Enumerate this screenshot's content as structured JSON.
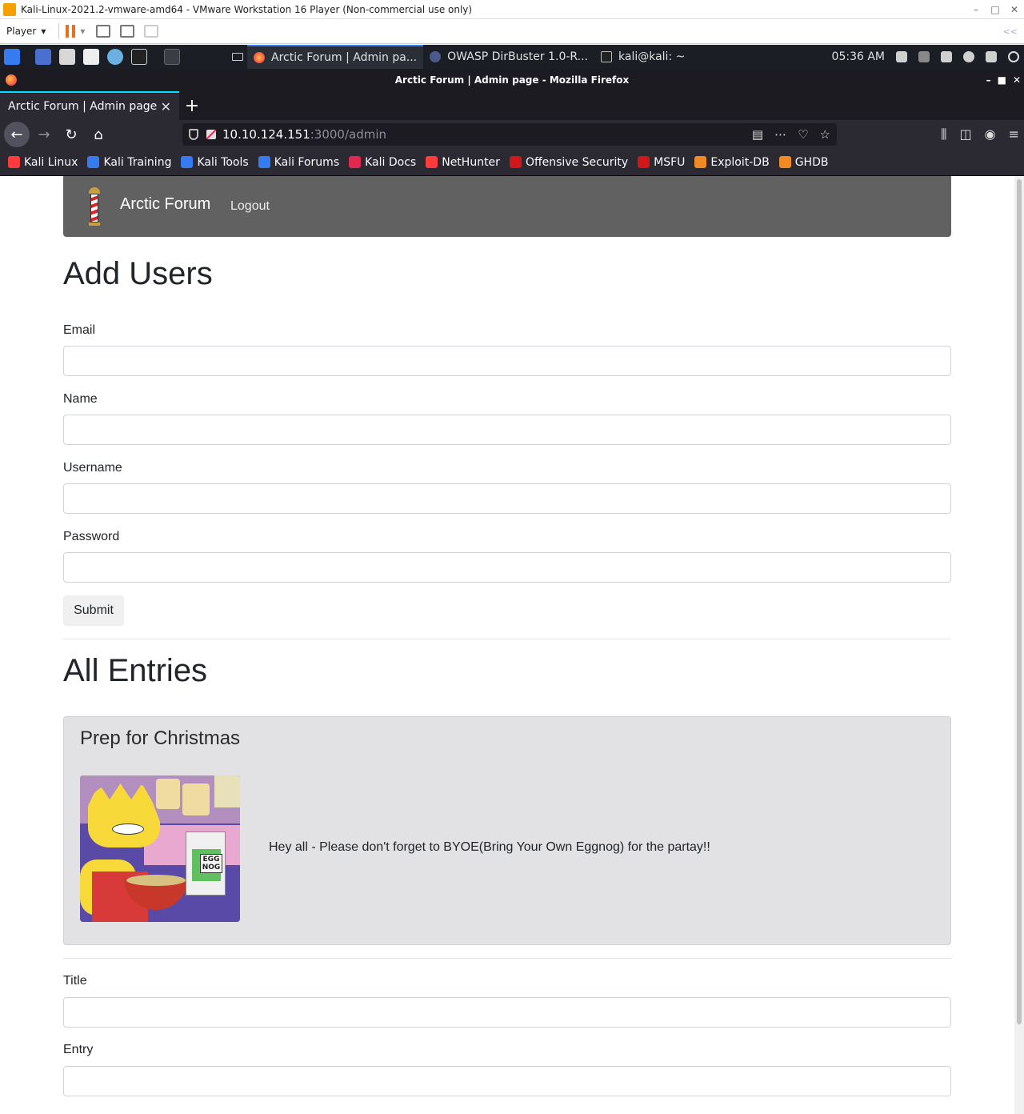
{
  "vmware": {
    "title": "Kali-Linux-2021.2-vmware-amd64 - VMware Workstation 16 Player (Non-commercial use only)",
    "player_menu": "Player",
    "window_controls": [
      "–",
      "□",
      "✕"
    ],
    "collapse_icon": "<<"
  },
  "kali_panel": {
    "tasks": [
      {
        "label": "Arctic Forum | Admin pa...",
        "icon": "firefox-icon",
        "active": true
      },
      {
        "label": "OWASP DirBuster 1.0-R...",
        "icon": "dirbuster-icon",
        "active": false
      },
      {
        "label": "kali@kali: ~",
        "icon": "terminal-icon",
        "active": false
      }
    ],
    "clock": "05:36 AM"
  },
  "firefox": {
    "window_title": "Arctic Forum | Admin page - Mozilla Firefox",
    "tab_title": "Arctic Forum | Admin page",
    "tab_close": "✕",
    "new_tab": "+",
    "url_host": "10.10.124.151",
    "url_path": ":3000/admin",
    "bookmarks": [
      {
        "label": "Kali Linux",
        "color": "#ff3b3b"
      },
      {
        "label": "Kali Training",
        "color": "#367bf0"
      },
      {
        "label": "Kali Tools",
        "color": "#367bf0"
      },
      {
        "label": "Kali Forums",
        "color": "#367bf0"
      },
      {
        "label": "Kali Docs",
        "color": "#e22850"
      },
      {
        "label": "NetHunter",
        "color": "#ff3b3b"
      },
      {
        "label": "Offensive Security",
        "color": "#d01818"
      },
      {
        "label": "MSFU",
        "color": "#d01818"
      },
      {
        "label": "Exploit-DB",
        "color": "#f08a24"
      },
      {
        "label": "GHDB",
        "color": "#f08a24"
      }
    ]
  },
  "site": {
    "brand": "Arctic Forum",
    "logout": "Logout",
    "add_users_heading": "Add Users",
    "email_label": "Email",
    "name_label": "Name",
    "username_label": "Username",
    "password_label": "Password",
    "submit_label": "Submit",
    "all_entries_heading": "All Entries",
    "entry": {
      "title": "Prep for Christmas",
      "image_text": "EGG NOG",
      "text": "Hey all - Please don't forget to BYOE(Bring Your Own Eggnog) for the partay!!"
    },
    "title_label": "Title",
    "entry_label": "Entry"
  }
}
